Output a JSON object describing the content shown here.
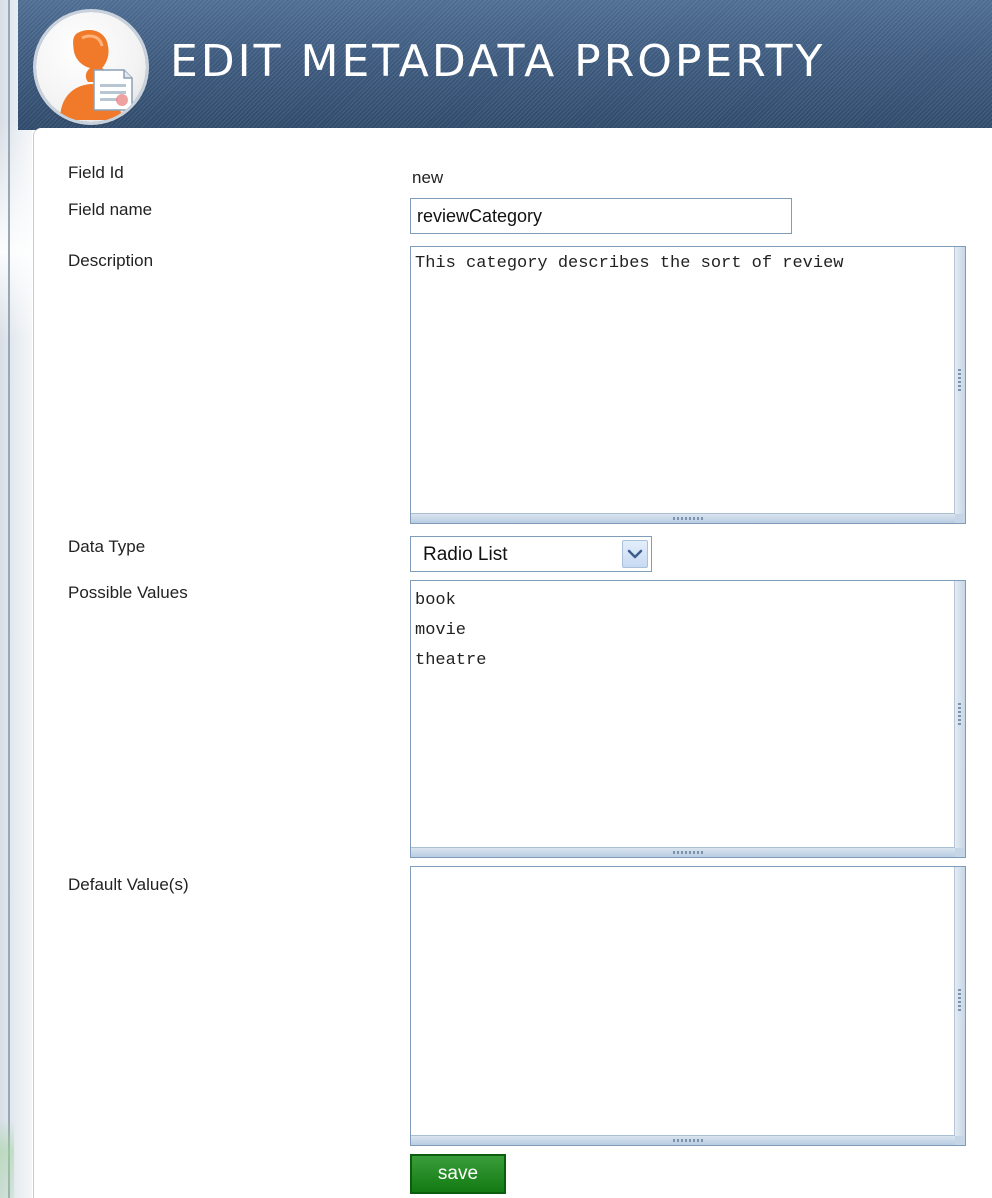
{
  "header": {
    "title": "EDIT METADATA PROPERTY",
    "avatar_icon": "user-document-icon"
  },
  "form": {
    "field_id": {
      "label": "Field Id",
      "value": "new"
    },
    "field_name": {
      "label": "Field name",
      "value": "reviewCategory"
    },
    "description": {
      "label": "Description",
      "value": "This category describes the sort of review"
    },
    "data_type": {
      "label": "Data Type",
      "selected": "Radio List"
    },
    "possible_values": {
      "label": "Possible Values",
      "value": "book\nmovie\ntheatre"
    },
    "default_values": {
      "label": "Default Value(s)",
      "value": ""
    },
    "save_label": "save"
  },
  "colors": {
    "header_bg": "#3d5a7e",
    "avatar_figure": "#f07a2a",
    "save_button": "#1f861f",
    "input_border": "#7f9db9"
  }
}
